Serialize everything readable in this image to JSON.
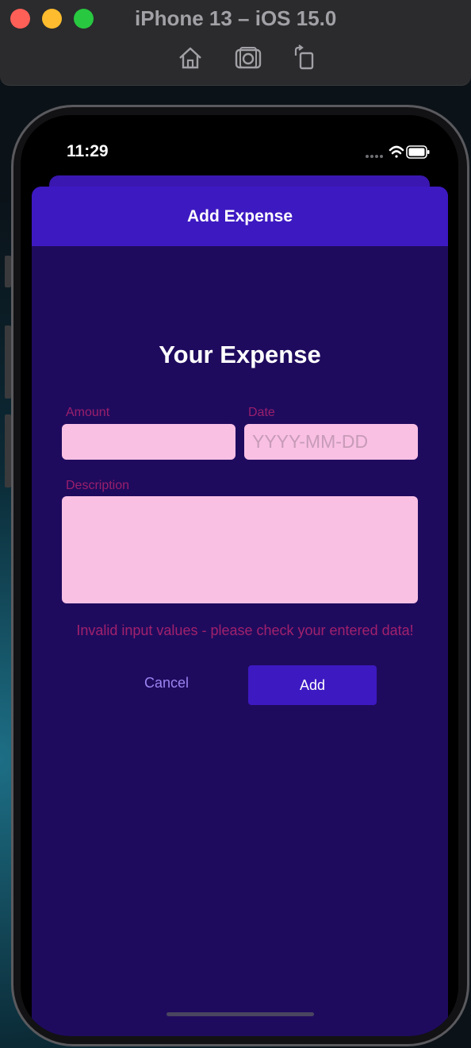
{
  "simulator": {
    "title": "iPhone 13 – iOS 15.0",
    "toolbar": [
      {
        "icon": "home-icon"
      },
      {
        "icon": "screenshot-camera-icon"
      },
      {
        "icon": "rotate-icon"
      }
    ]
  },
  "status_bar": {
    "time": "11:29",
    "icons": [
      "cellular-dots-icon",
      "wifi-icon",
      "battery-icon"
    ]
  },
  "header": {
    "title": "Add Expense"
  },
  "form": {
    "title": "Your Expense",
    "amount": {
      "label": "Amount",
      "value": "",
      "placeholder": ""
    },
    "date": {
      "label": "Date",
      "value": "",
      "placeholder": "YYYY-MM-DD"
    },
    "description": {
      "label": "Description",
      "value": "",
      "placeholder": ""
    },
    "error_message": "Invalid input values - please check your entered data!",
    "cancel_label": "Cancel",
    "add_label": "Add"
  },
  "colors": {
    "header_bg": "#3d19c2",
    "screen_bg": "#1f0b5e",
    "input_bg": "#f9c0e4",
    "label": "#9a1f6c",
    "error": "#a1216d",
    "cancel_text": "#9b84f0"
  }
}
